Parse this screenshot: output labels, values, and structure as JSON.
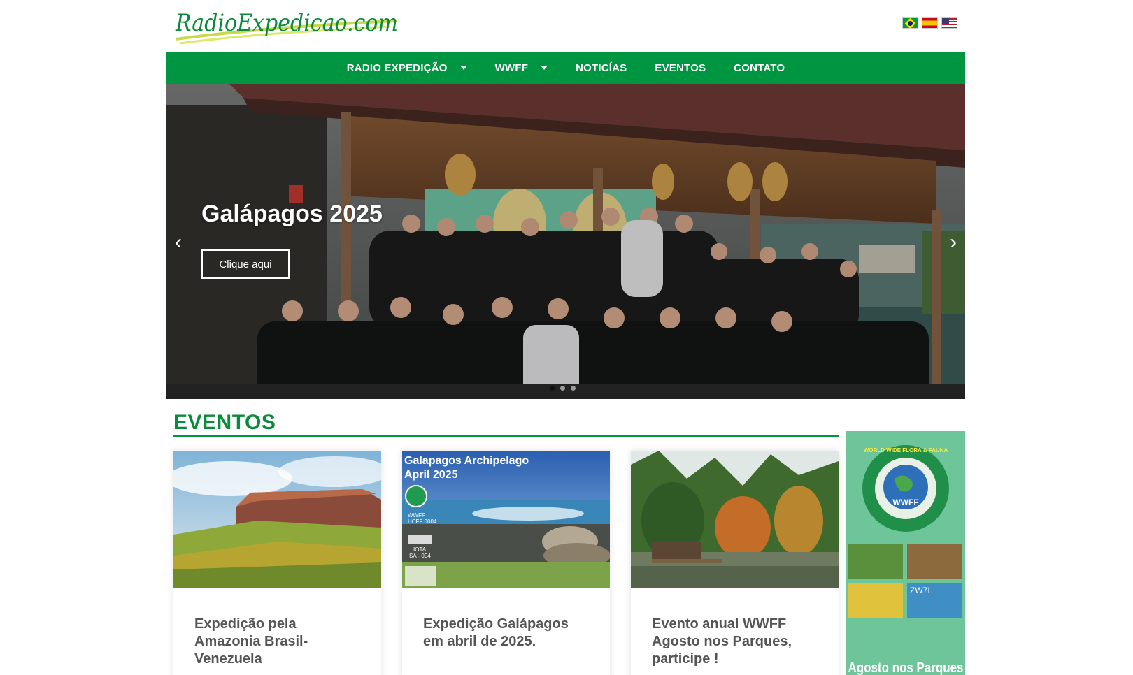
{
  "header": {
    "logo_text": "RadioExpedicao.com",
    "flags": [
      {
        "name": "flag-brazil-icon",
        "colors": [
          "#009c3b",
          "#ffdf00",
          "#002776"
        ]
      },
      {
        "name": "flag-spain-icon",
        "colors": [
          "#c60b1e",
          "#ffc400"
        ]
      },
      {
        "name": "flag-usa-icon",
        "colors": [
          "#b22234",
          "#ffffff",
          "#3c3b6e"
        ]
      }
    ]
  },
  "nav": {
    "items": [
      {
        "label": "RADIO EXPEDIÇÃO",
        "dropdown": true
      },
      {
        "label": "WWFF",
        "dropdown": true
      },
      {
        "label": "NOTICÍAS",
        "dropdown": false
      },
      {
        "label": "EVENTOS",
        "dropdown": false
      },
      {
        "label": "CONTATO",
        "dropdown": false
      }
    ],
    "color": "#009540"
  },
  "hero": {
    "title": "Galápagos 2025",
    "button_label": "Clique aqui",
    "prev_icon": "‹",
    "next_icon": "›",
    "slides": 3,
    "active_slide": 1
  },
  "events": {
    "section_title": "EVENTOS",
    "cards": [
      {
        "title": "Expedição pela Amazonia Brasil-Venezuela"
      },
      {
        "title": "Expedição Galápagos em abril de 2025.",
        "image_caption_1": "Galapagos Archipelago",
        "image_caption_2": "April 2025",
        "image_tag_1": "WWFF",
        "image_tag_2": "HCFF 0004",
        "image_tag_3": "IOTA",
        "image_tag_4": "SA - 004"
      },
      {
        "title": "Evento anual WWFF Agosto nos Parques, participe !"
      }
    ]
  },
  "sidebar_ad": {
    "badge_text_1": "WORLD WIDE FLORA & FAUNA",
    "badge_text_2": "WWFF",
    "callsign": "ZW7I",
    "bottom_text": "Agosto nos Parques",
    "accent": "#6fc59a"
  }
}
